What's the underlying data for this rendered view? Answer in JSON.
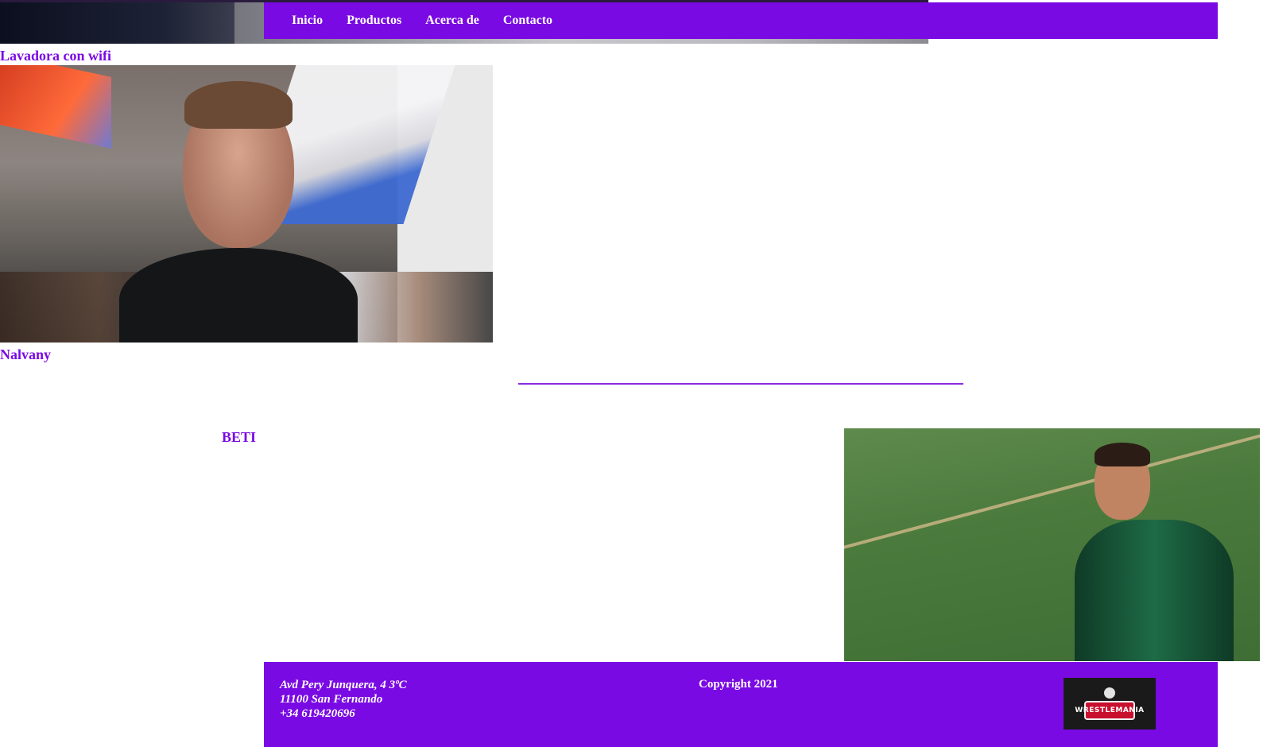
{
  "nav": {
    "items": [
      {
        "label": "Inicio"
      },
      {
        "label": "Productos"
      },
      {
        "label": "Acerca de"
      },
      {
        "label": "Contacto"
      }
    ]
  },
  "main": {
    "caption1": "Lavadora con wifi",
    "caption2": "Nalvany",
    "section_title": "BETI"
  },
  "footer": {
    "address_line1": "Avd Pery Junquera, 4 3ºC",
    "address_line2": "11100 San Fernando",
    "phone": "+34 619420696",
    "copyright": "Copyright 2021",
    "logo_text": "WRESTLEMANIA"
  },
  "colors": {
    "accent": "#7a0ae3",
    "divider": "#8a2be2"
  }
}
